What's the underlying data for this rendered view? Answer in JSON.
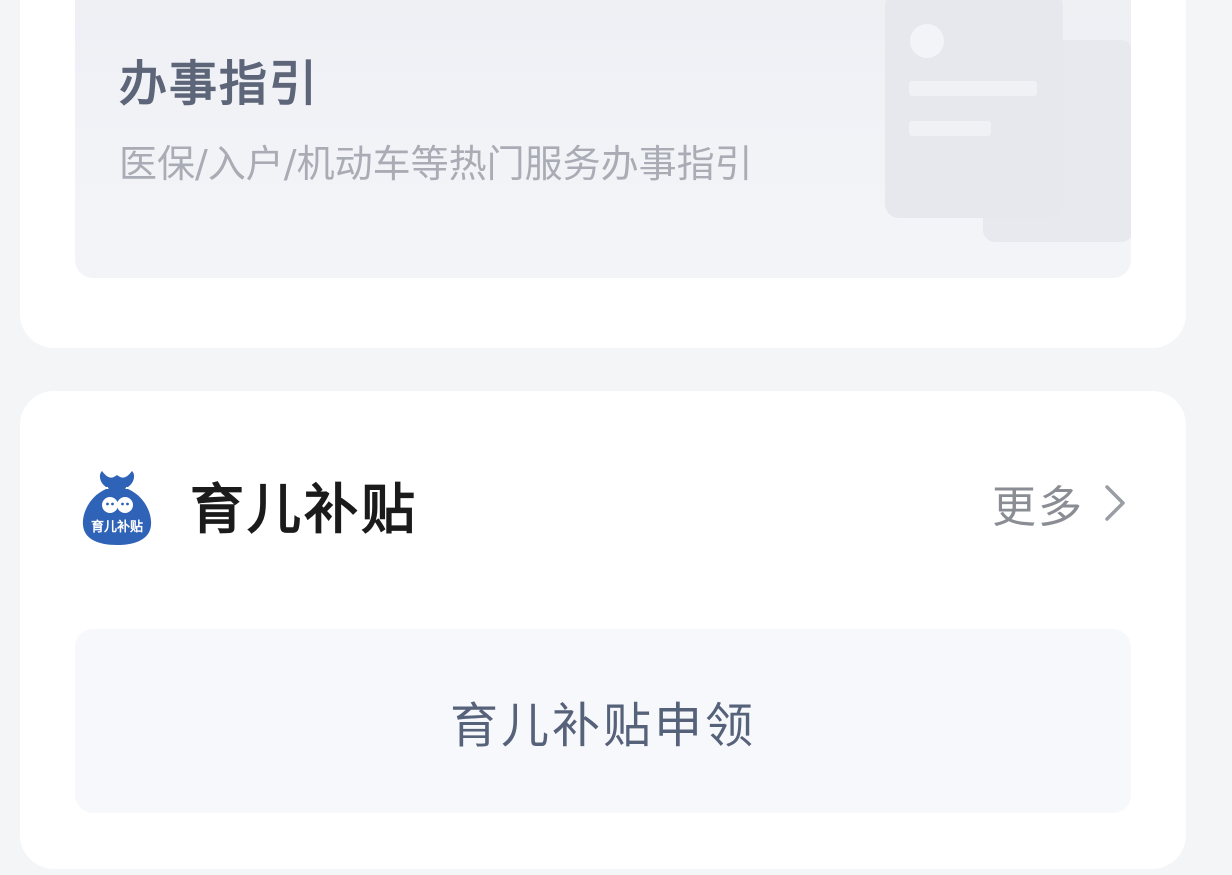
{
  "guide": {
    "title": "办事指引",
    "subtitle": "医保/入户/机动车等热门服务办事指引",
    "illustration_icon": "document-card-icon"
  },
  "childcare": {
    "logo_icon": "money-bag-logo-icon",
    "logo_text": "育儿补贴",
    "title": "育儿补贴",
    "more_label": "更多",
    "more_icon": "chevron-right-icon",
    "apply_label": "育儿补贴申领"
  },
  "colors": {
    "logo_blue": "#2f63b8",
    "title_text": "#1b1b1b",
    "muted_text": "#8a8d93",
    "apply_text": "#56617a",
    "card_bg": "#ffffff",
    "page_bg": "#f4f5f7"
  }
}
